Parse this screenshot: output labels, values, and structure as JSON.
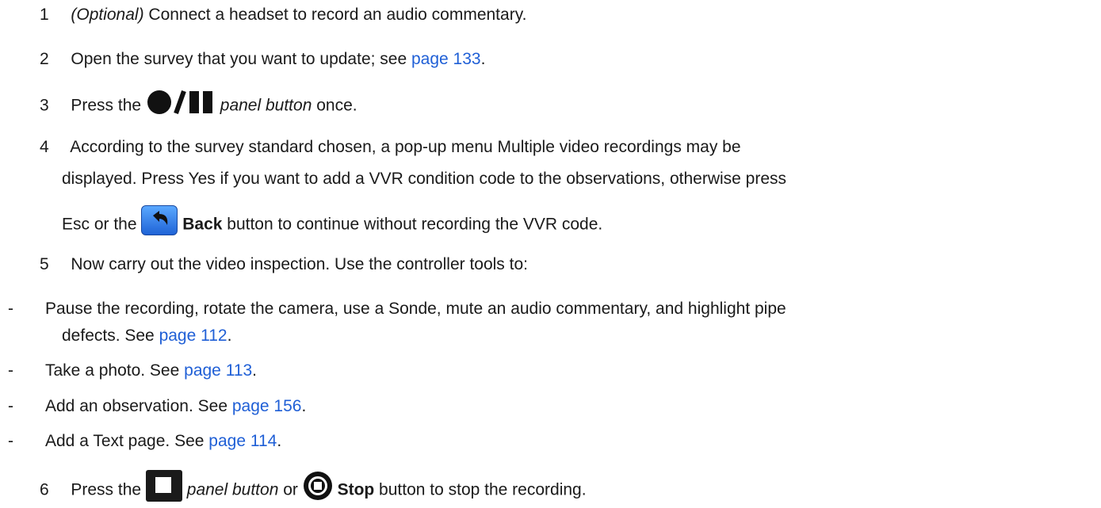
{
  "steps": [
    {
      "num": "1",
      "optional": "(Optional)",
      "text": " Connect a headset to record an audio commentary."
    },
    {
      "num": "2",
      "text": "Open the survey that you want to update; see ",
      "link": "page 133",
      "end": "."
    },
    {
      "num": "3",
      "pre": "Press the ",
      "icon": "record-pause-icon",
      "post": "panel button",
      "end": " once."
    },
    {
      "num": "4",
      "line1": "According to the survey standard chosen, a pop-up menu Multiple video recordings may be",
      "line2": "displayed. Press Yes if you want to add a VVR condition code to the observations, otherwise press",
      "line3_pre": "Esc or the ",
      "back_label": "Back",
      "line3_post": " button to continue without recording the VVR code."
    },
    {
      "num": "5",
      "text": "Now carry out the video inspection. Use the controller tools to:"
    },
    {
      "num": "6",
      "pre": "Press the ",
      "panel": "panel button",
      "mid": " or ",
      "stop_label": "Stop",
      "post": " button to stop the recording."
    }
  ],
  "bullets": [
    {
      "dash": "-",
      "line1": "Pause the recording, rotate the camera, use a Sonde, mute an audio commentary, and highlight pipe",
      "line2": "defects. See ",
      "link": "page 112",
      "end": "."
    },
    {
      "dash": "-",
      "text": "Take a photo. See ",
      "link": "page 113",
      "end": "."
    },
    {
      "dash": "-",
      "text": "Add an observation. See ",
      "link": "page 156",
      "end": "."
    },
    {
      "dash": "-",
      "text": "Add a Text page. See ",
      "link": "page 114",
      "end": "."
    }
  ],
  "colors": {
    "link": "#1f5fd6",
    "text": "#1a1a1a",
    "back_button": "#2f7ff0"
  }
}
